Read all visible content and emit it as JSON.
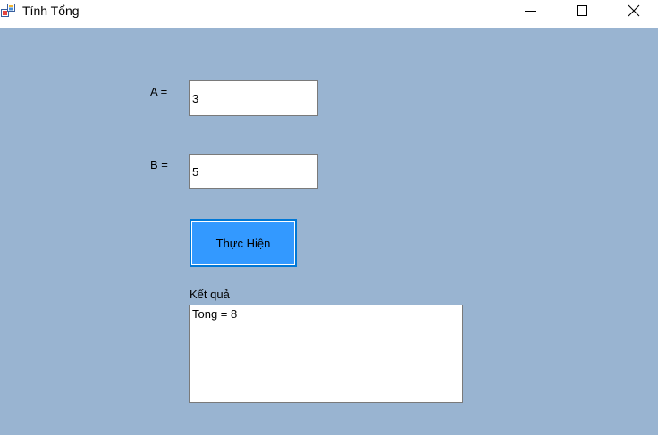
{
  "window": {
    "title": "Tính Tổng",
    "controls": {
      "minimize_icon": "minimize-icon",
      "maximize_icon": "maximize-icon",
      "close_icon": "close-icon"
    }
  },
  "form": {
    "label_a": "A =",
    "input_a_value": "3",
    "label_b": "B =",
    "input_b_value": "5",
    "execute_button_label": "Thực Hiện",
    "result_label": "Kết quả",
    "result_value": "Tong = 8"
  },
  "colors": {
    "client_background": "#99b4d1",
    "button_background": "#3399ff",
    "button_border": "#0078d7"
  }
}
